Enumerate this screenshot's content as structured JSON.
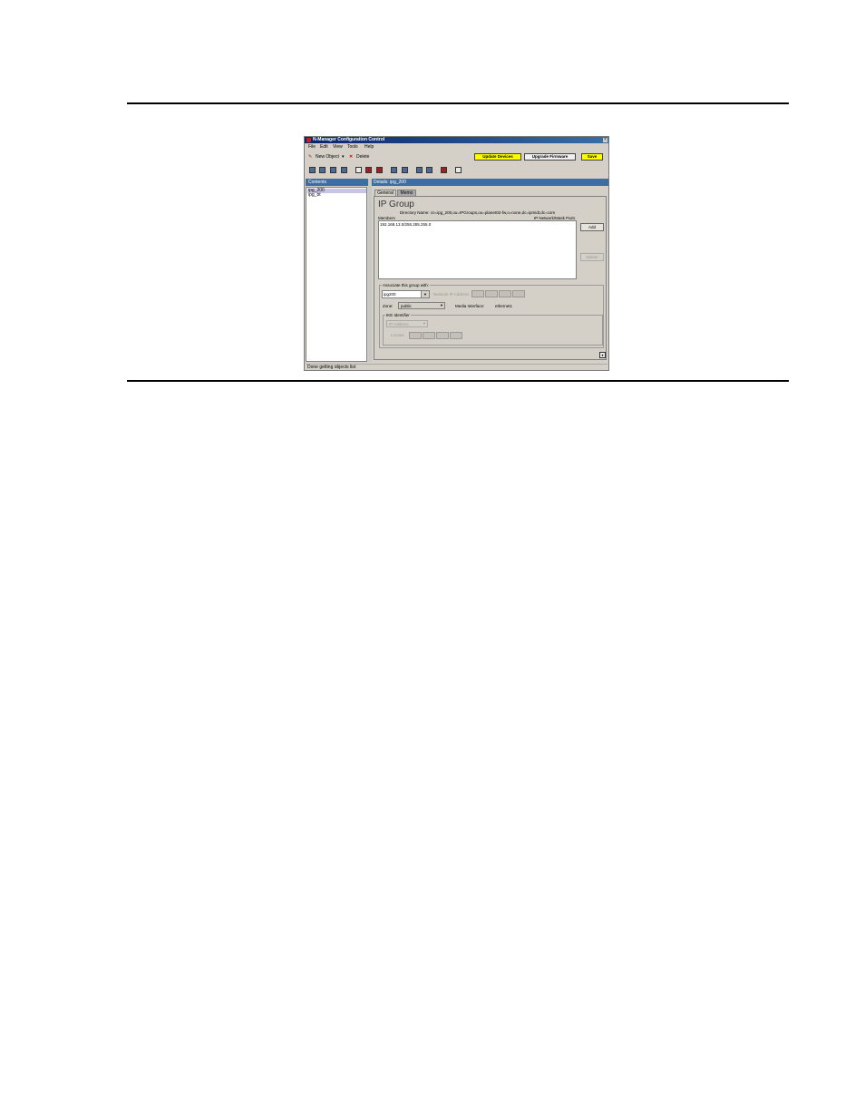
{
  "window": {
    "title": "N-Manager Configuration Control"
  },
  "menu": [
    "File",
    "Edit",
    "View",
    "Tools",
    "Help"
  ],
  "toolbar": {
    "new_object": "New Object",
    "new_arrow": "▾",
    "delete": "Delete",
    "update_devices": "Update Devices",
    "upgrade_firmware": "Upgrade Firmware",
    "save": "Save"
  },
  "colors": {
    "highlight_button": "#ffff00",
    "header_blue": "#3a6ea5"
  },
  "contents": {
    "header": "Contents",
    "items": [
      "ipg_200",
      "ipg_bt"
    ],
    "selected_index": 0
  },
  "details": {
    "header": "Details: ipg_200",
    "tabs": [
      "General",
      "Memo"
    ],
    "active_tab": "General",
    "title": "IP Group",
    "directory_name": "Directory Name: cn=ipg_200,ou=IPGroups,ou=planet02-fw,o=none,dc=ipmidt,dc=com",
    "members_label": "Members",
    "members_column": "IP Network/Mask Pairs",
    "members": [
      "192.168.13.0/255.255.255.0"
    ],
    "add_button": "Add",
    "delete_button": "Delete",
    "associate": {
      "legend": "Associate this group with:",
      "selected": "ipg200",
      "network_address_label": "Network IP Address",
      "zone_label": "Zone:",
      "zone_value": "public",
      "media_interface_label": "Media Interface:",
      "media_interface_value": "ethernet1"
    },
    "ike": {
      "legend": "IKE Identifier",
      "type_value": "IP Address",
      "locator_label": "Locator"
    }
  },
  "status": "Done getting objects list"
}
